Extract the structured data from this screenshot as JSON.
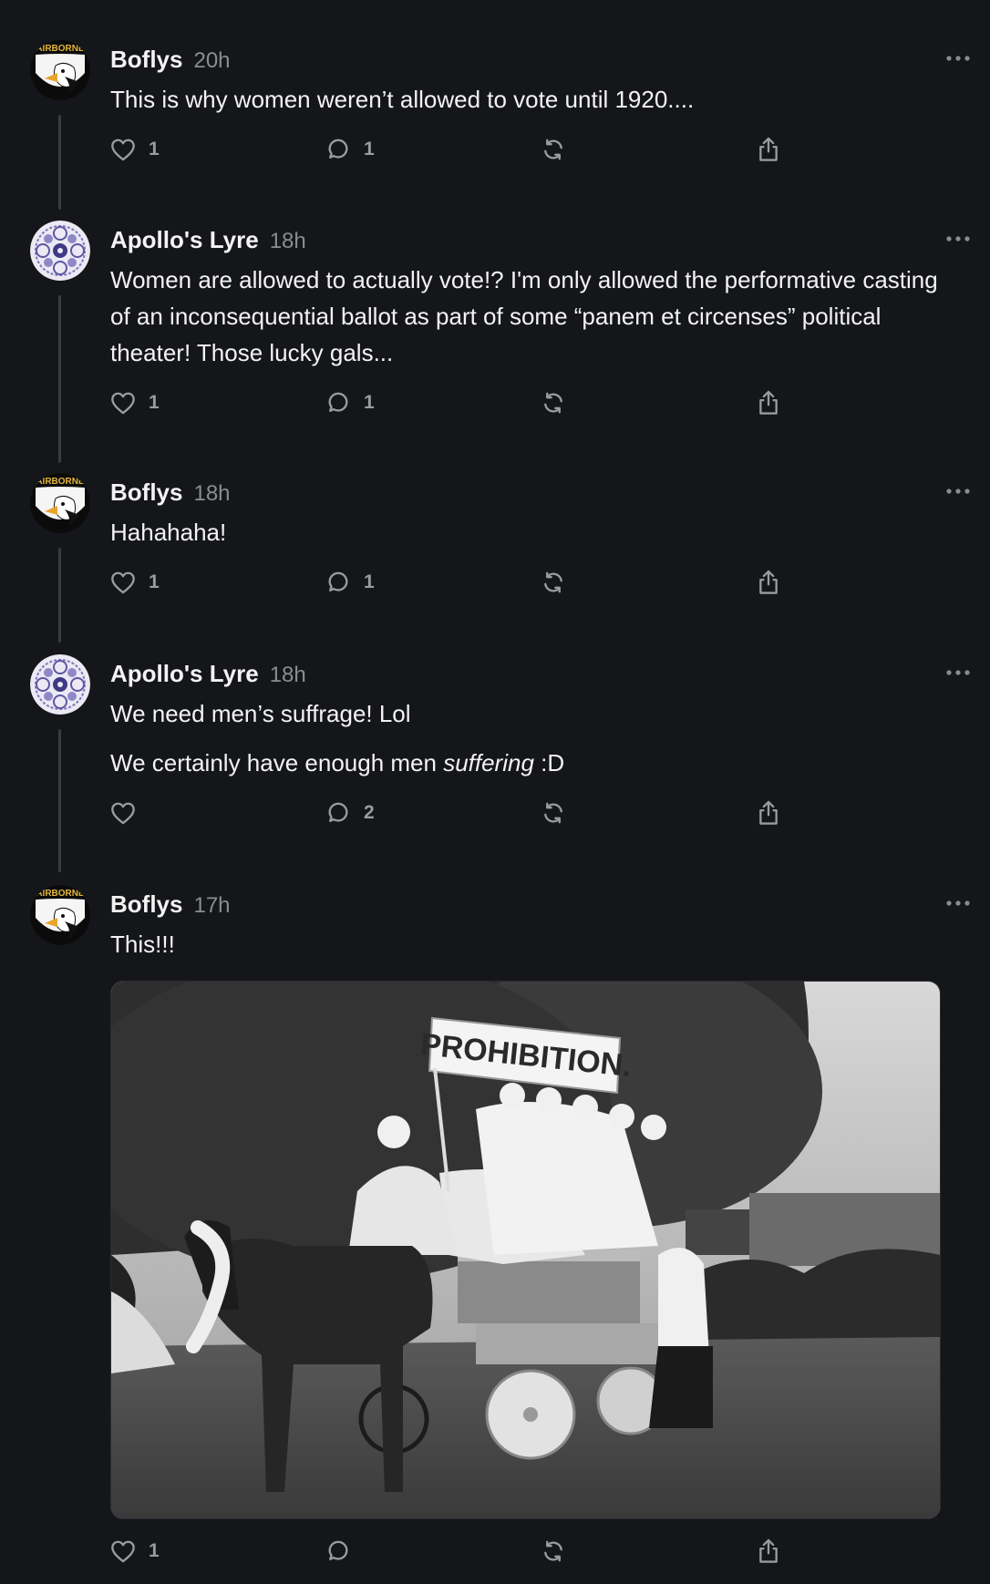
{
  "posts": [
    {
      "author": "Boflys",
      "time": "20h",
      "avatar": "airborne-eagle",
      "paragraphs": [
        "This is why women weren’t allowed to vote until 1920...."
      ],
      "likes": "1",
      "replies": "1"
    },
    {
      "author": "Apollo's Lyre",
      "time": "18h",
      "avatar": "mandala",
      "paragraphs": [
        "Women are allowed to actually vote!? I'm only allowed the performative casting of an inconsequential ballot as part of some “panem et circenses” political theater! Those lucky gals..."
      ],
      "likes": "1",
      "replies": "1"
    },
    {
      "author": "Boflys",
      "time": "18h",
      "avatar": "airborne-eagle",
      "paragraphs": [
        "Hahahaha!"
      ],
      "likes": "1",
      "replies": "1"
    },
    {
      "author": "Apollo's Lyre",
      "time": "18h",
      "avatar": "mandala",
      "paragraphs": [
        "We need men’s suffrage! Lol"
      ],
      "second_line": {
        "before": "We certainly have enough men ",
        "emphasis": "suffering",
        "after": " :D"
      },
      "likes": "",
      "replies": "2"
    },
    {
      "author": "Boflys",
      "time": "17h",
      "avatar": "airborne-eagle",
      "paragraphs": [
        "This!!!"
      ],
      "media_sign_text": "PROHIBITION.",
      "likes": "1",
      "replies": ""
    }
  ],
  "avatar_badge_text": "AIRBORNE",
  "icons": {
    "like": "heart-icon",
    "reply": "comment-icon",
    "repost": "repost-icon",
    "share": "share-icon",
    "more": "more-dots-icon"
  },
  "colors": {
    "background": "#15161a",
    "text": "#f3f3f3",
    "muted": "#8b8c91",
    "thread_line": "#3a3b40"
  }
}
